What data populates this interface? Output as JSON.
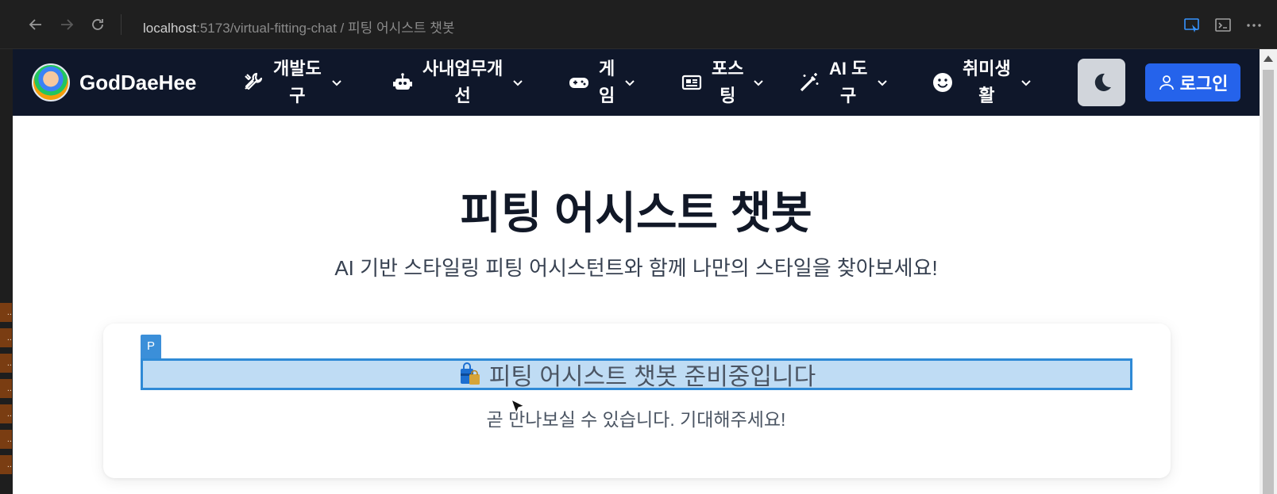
{
  "browser": {
    "url_host": "localhost",
    "url_path": ":5173/virtual-fitting-chat / 피팅 어시스트 챗봇",
    "icons": [
      "back-arrow-icon",
      "forward-arrow-icon",
      "reload-icon",
      "inspect-icon",
      "terminal-icon",
      "more-icon"
    ]
  },
  "navbar": {
    "brand": "GodDaeHee",
    "items": [
      {
        "line1": "개발도",
        "line2": "구",
        "icon": "tools-icon"
      },
      {
        "line1": "사내업무개",
        "line2": "선",
        "icon": "robot-icon"
      },
      {
        "line1": "게",
        "line2": "임",
        "icon": "gamepad-icon"
      },
      {
        "line1": "포스",
        "line2": "팅",
        "icon": "newspaper-icon"
      },
      {
        "line1": "AI 도",
        "line2": "구",
        "icon": "magic-wand-icon"
      },
      {
        "line1": "취미생",
        "line2": "활",
        "icon": "smile-icon"
      }
    ],
    "login_label": "로그인",
    "colors": {
      "background": "#0f172a",
      "login": "#2563eb",
      "theme_button": "#d1d5db"
    }
  },
  "main": {
    "title": "피팅 어시스트 챗봇",
    "subtitle": "AI 기반 스타일링 피팅 어시스턴트와 함께 나만의 스타일을 찾아보세요!",
    "card": {
      "badge": "P",
      "heading": "피팅 어시스트 챗봇 준비중입니다",
      "description": "곧 만나보실 수 있습니다. 기대해주세요!"
    }
  },
  "gutter": {
    "tab_text": ".."
  }
}
